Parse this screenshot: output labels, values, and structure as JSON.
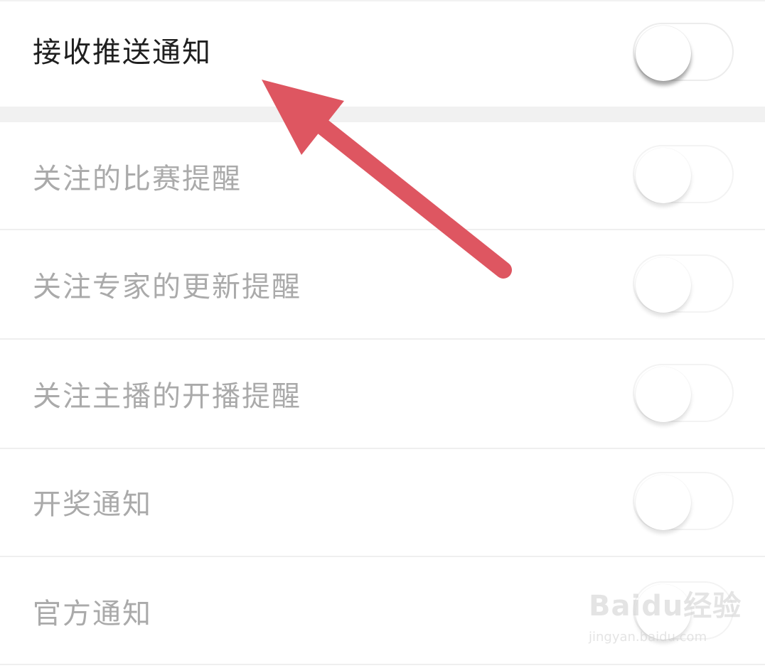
{
  "settings": {
    "main": {
      "label": "接收推送通知",
      "enabled": false
    },
    "items": [
      {
        "label": "关注的比赛提醒",
        "enabled": false
      },
      {
        "label": "关注专家的更新提醒",
        "enabled": false
      },
      {
        "label": "关注主播的开播提醒",
        "enabled": false
      },
      {
        "label": "开奖通知",
        "enabled": false
      },
      {
        "label": "官方通知",
        "enabled": false
      }
    ]
  },
  "annotation": {
    "arrow_color": "#de5661"
  },
  "watermark": {
    "brand": "Baidu经验",
    "url": "jingyan.baidu.com"
  },
  "colors": {
    "active_text": "#1f1f1f",
    "disabled_text": "#aaaaaa",
    "divider": "#efefef",
    "background": "#ffffff"
  }
}
